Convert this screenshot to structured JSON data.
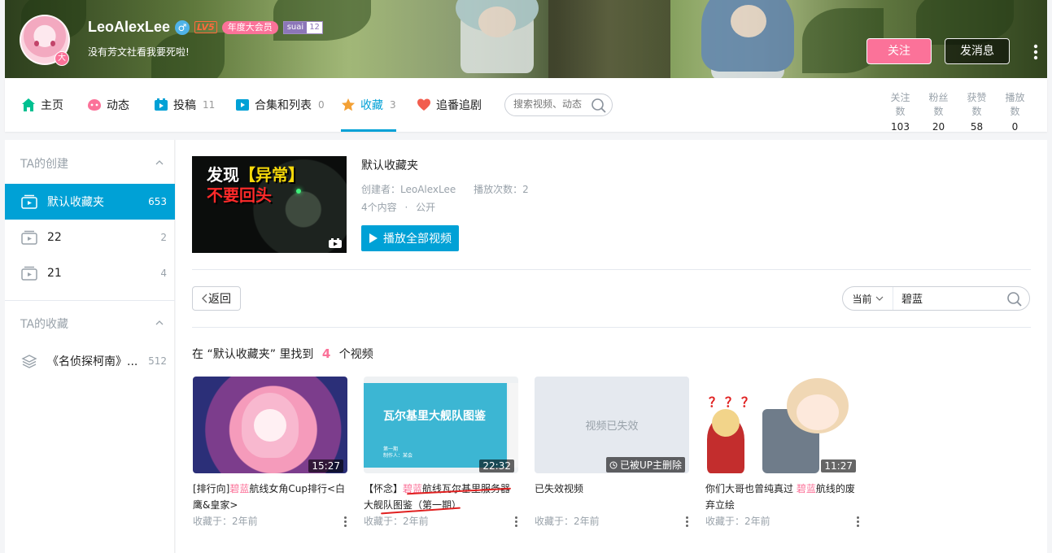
{
  "header": {
    "username": "LeoAlexLee",
    "gender_symbol": "♂",
    "level": "LV5",
    "vip_label": "年度大会员",
    "medal": {
      "name": "suai",
      "level": "12"
    },
    "signature": "没有芳文社看我要死啦!",
    "avatar_badge": "大",
    "follow_label": "关注",
    "message_label": "发消息"
  },
  "nav": {
    "tabs": [
      {
        "label": "主页",
        "count": "",
        "icon": "home-icon",
        "color": "#00c091"
      },
      {
        "label": "动态",
        "count": "",
        "icon": "dynamic-icon",
        "color": "#fb7299"
      },
      {
        "label": "投稿",
        "count": "11",
        "icon": "upload-icon",
        "color": "#00a1d6"
      },
      {
        "label": "合集和列表",
        "count": "0",
        "icon": "collection-icon",
        "color": "#00a1d6"
      },
      {
        "label": "收藏",
        "count": "3",
        "icon": "star-icon",
        "color": "#f3a034",
        "active": true
      },
      {
        "label": "追番追剧",
        "count": "",
        "icon": "heart-icon",
        "color": "#f25d4e"
      }
    ],
    "search_placeholder": "搜索视频、动态",
    "stats": [
      {
        "label": "关注数",
        "value": "103"
      },
      {
        "label": "粉丝数",
        "value": "20"
      },
      {
        "label": "获赞数",
        "value": "58"
      },
      {
        "label": "播放数",
        "value": "0"
      }
    ]
  },
  "sidebar": {
    "created_title": "TA的创建",
    "created": [
      {
        "name": "默认收藏夹",
        "count": "653",
        "active": true
      },
      {
        "name": "22",
        "count": "2"
      },
      {
        "name": "21",
        "count": "4"
      }
    ],
    "collected_title": "TA的收藏",
    "collected": [
      {
        "name": "《名侦探柯南》...",
        "count": "512"
      }
    ]
  },
  "folder": {
    "cover_text_1": "发现",
    "cover_text_1_highlight": "【异常】",
    "cover_text_2": "不要回头",
    "title": "默认收藏夹",
    "creator_label": "创建者：",
    "creator": "LeoAlexLee",
    "plays_label": "播放次数：",
    "plays": "2",
    "content_count": "4个内容",
    "separator": "·",
    "visibility": "公开",
    "play_all_label": "播放全部视频"
  },
  "toolbar": {
    "back_label": "返回",
    "scope": "当前",
    "search_value": "碧蓝"
  },
  "result": {
    "prefix": "在",
    "folder": "“默认收藏夹”",
    "middle": "里找到",
    "count": "4",
    "suffix": "个视频"
  },
  "videos": [
    {
      "title_pre": "[排行向]",
      "keyword": "碧蓝",
      "title_post": "航线女角Cup排行<白鹰&皇家>",
      "duration": "15:27",
      "collected_label": "收藏于：",
      "collected_time": "2年前"
    },
    {
      "title_pre": "【怀念】",
      "keyword": "碧蓝",
      "title_post": "航线瓦尔基里服务器大舰队图鉴（第一期）",
      "duration": "22:32",
      "thumb_title": "瓦尔基里大舰队图鉴",
      "thumb_sub1": "第一期",
      "thumb_sub2": "制作人：某会",
      "collected_label": "收藏于：",
      "collected_time": "2年前"
    },
    {
      "title_pre": "已失效视频",
      "keyword": "",
      "title_post": "",
      "duration": "已被UP主删除",
      "thumb_title": "视频已失效",
      "collected_label": "收藏于：",
      "collected_time": "2年前"
    },
    {
      "title_pre": "你们大哥也曾纯真过 ",
      "keyword": "碧蓝",
      "title_post": "航线的废弃立绘",
      "duration": "11:27",
      "thumb_marks": "？？？",
      "collected_label": "收藏于：",
      "collected_time": "2年前"
    }
  ]
}
